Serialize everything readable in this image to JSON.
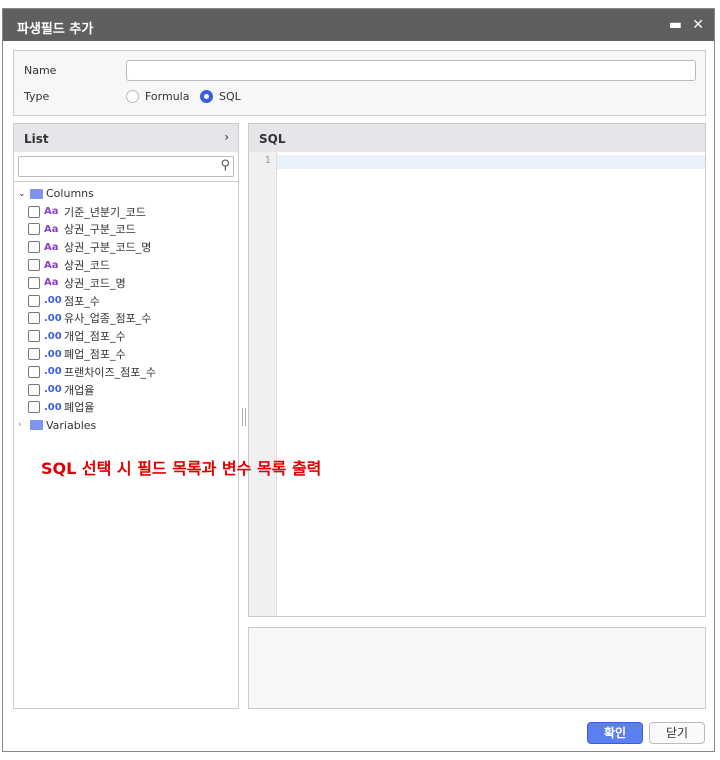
{
  "dialog": {
    "title": "파생필드 추가"
  },
  "form": {
    "name_label": "Name",
    "name_value": "",
    "type_label": "Type",
    "type_options": [
      "Formula",
      "SQL"
    ],
    "type_selected": "SQL"
  },
  "list": {
    "title": "List",
    "search_placeholder": "",
    "columns_folder": "Columns",
    "variables_folder": "Variables",
    "columns": [
      {
        "type": "Aa",
        "name": "기준_년분기_코드"
      },
      {
        "type": "Aa",
        "name": "상권_구분_코드"
      },
      {
        "type": "Aa",
        "name": "상권_구분_코드_명"
      },
      {
        "type": "Aa",
        "name": "상권_코드"
      },
      {
        "type": "Aa",
        "name": "상권_코드_명"
      },
      {
        "type": ".00",
        "name": "점포_수"
      },
      {
        "type": ".00",
        "name": "유사_업종_점포_수"
      },
      {
        "type": ".00",
        "name": "개업_점포_수"
      },
      {
        "type": ".00",
        "name": "폐업_점포_수"
      },
      {
        "type": ".00",
        "name": "프랜차이즈_점포_수"
      },
      {
        "type": ".00",
        "name": "개업율"
      },
      {
        "type": ".00",
        "name": "폐업율"
      }
    ]
  },
  "sql": {
    "title": "SQL",
    "line_number": "1"
  },
  "annotation": "SQL 선택 시 필드 목록과 변수 목록 출력",
  "buttons": {
    "ok": "확인",
    "close": "닫기"
  }
}
